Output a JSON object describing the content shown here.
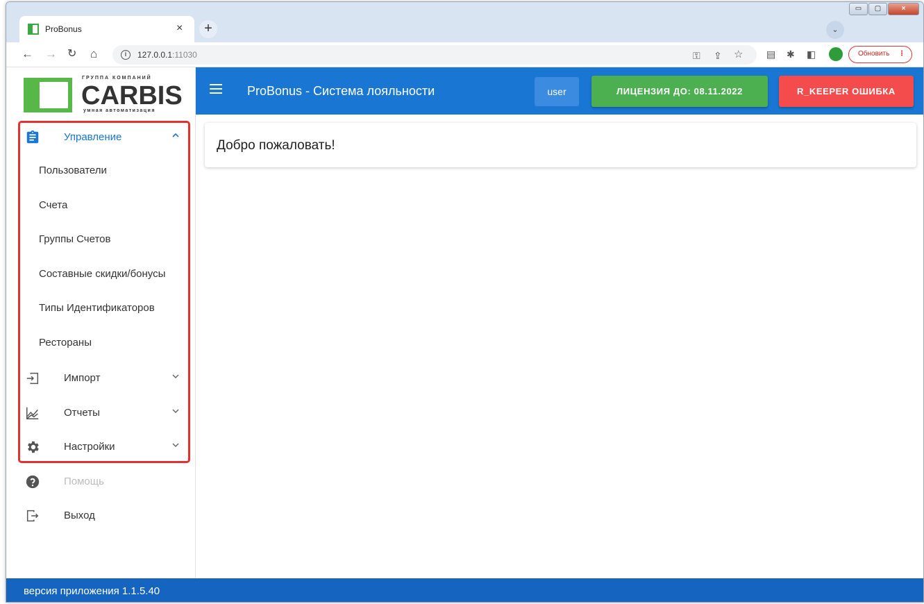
{
  "browser": {
    "tab_title": "ProBonus",
    "tab_close": "×",
    "new_tab": "+",
    "url_host": "127.0.0.1",
    "url_port": ":11030",
    "update_label": "Обновить",
    "window_controls": [
      "▭",
      "▢",
      "×"
    ]
  },
  "logo": {
    "top": "ГРУППА КОМПАНИЙ",
    "name": "CARBIS",
    "sub": "умная автоматизация"
  },
  "appbar": {
    "title": "ProBonus - Система лояльности",
    "user": "user",
    "license": "ЛИЦЕНЗИЯ ДО: 08.11.2022",
    "error": "R_KEEPER ОШИБКА"
  },
  "sidebar": {
    "management": {
      "label": "Управление",
      "icon": "clipboard-icon",
      "expanded": true,
      "items": [
        "Пользователи",
        "Счета",
        "Группы Счетов",
        "Составные скидки/бонусы",
        "Типы Идентификаторов",
        "Рестораны"
      ]
    },
    "import": {
      "label": "Импорт",
      "icon": "import-icon"
    },
    "reports": {
      "label": "Отчеты",
      "icon": "chart-icon"
    },
    "settings": {
      "label": "Настройки",
      "icon": "gear-icon"
    },
    "help": {
      "label": "Помощь",
      "icon": "help-icon"
    },
    "exit": {
      "label": "Выход",
      "icon": "logout-icon"
    }
  },
  "main": {
    "welcome": "Добро пожаловать!"
  },
  "footer": {
    "version": "версия приложения 1.1.5.40"
  },
  "colors": {
    "primary": "#1976d2",
    "success": "#4caf50",
    "error": "#f44c4c",
    "highlight_frame": "#e3312e",
    "footer": "#1565c0"
  }
}
